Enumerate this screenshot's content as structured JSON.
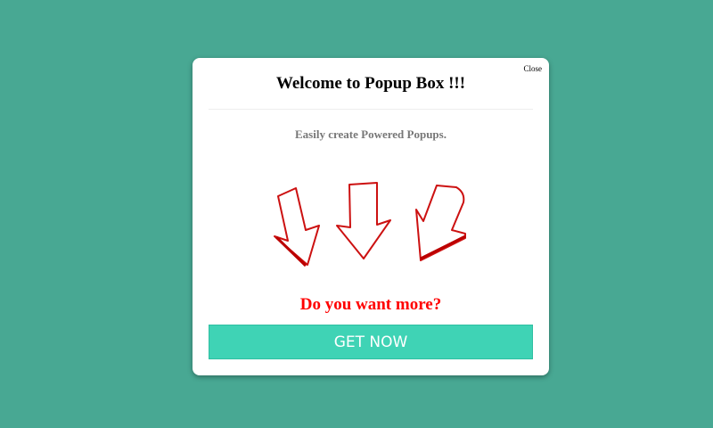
{
  "popup": {
    "close_label": "Close",
    "title": "Welcome to Popup Box !!!",
    "subtitle": "Easily create Powered Popups.",
    "question": "Do you want more?",
    "cta_label": "GET NOW"
  },
  "colors": {
    "background": "#48a893",
    "accent": "#3fd3b5",
    "question": "#ff0000",
    "arrow": "#cc1111"
  }
}
